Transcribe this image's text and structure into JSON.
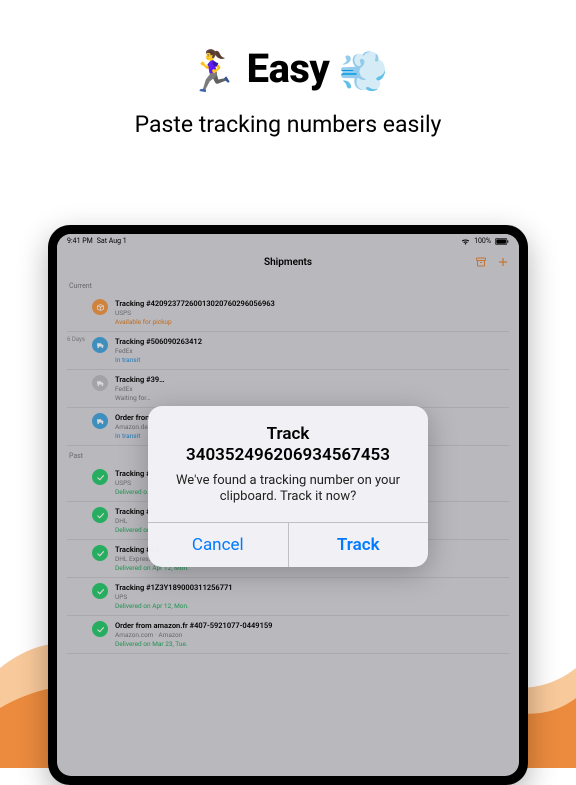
{
  "hero": {
    "emoji_left": "🏃‍♀️",
    "title": "Easy",
    "emoji_right": "💨",
    "subtitle": "Paste tracking numbers easily"
  },
  "status": {
    "time": "9:41 PM",
    "date": "Sat Aug 1",
    "battery": "100%"
  },
  "nav": {
    "title": "Shipments",
    "archive_icon": "archive-icon",
    "add_icon": "plus-icon"
  },
  "sections": {
    "current": "Current",
    "past": "Past"
  },
  "shipments_current": [
    {
      "pre": "",
      "icon": "orange",
      "glyph": "box",
      "title": "Tracking #42092377260013020760296056963",
      "sub": "USPS",
      "status": "Available for pickup",
      "status_cls": "c-orange"
    },
    {
      "pre": "6 Days",
      "icon": "blue",
      "glyph": "truck",
      "title": "Tracking #506090263412",
      "sub": "FedEx",
      "status": "In transit",
      "status_cls": "c-blue"
    },
    {
      "pre": "",
      "icon": "gray",
      "glyph": "truck",
      "title": "Tracking #39…",
      "sub": "FedEx",
      "status": "Waiting for…",
      "status_cls": "c-gray"
    },
    {
      "pre": "",
      "icon": "blue",
      "glyph": "truck",
      "title": "Order from…",
      "sub": "Amazon.de…",
      "status": "In transit",
      "status_cls": "c-blue"
    }
  ],
  "shipments_past": [
    {
      "pre": "",
      "icon": "green",
      "glyph": "check",
      "title": "Tracking #…",
      "sub": "USPS",
      "status": "Delivered o…",
      "status_cls": "c-green"
    },
    {
      "pre": "",
      "icon": "green",
      "glyph": "check",
      "title": "Tracking #…",
      "sub": "DHL",
      "status": "Delivered on…",
      "status_cls": "c-green"
    },
    {
      "pre": "",
      "icon": "green",
      "glyph": "check",
      "title": "Tracking #24…",
      "sub": "DHL Express",
      "status": "Delivered on Apr 12, Mon.",
      "status_cls": "c-green"
    },
    {
      "pre": "",
      "icon": "green",
      "glyph": "check",
      "title": "Tracking #1Z3Y189000311256771",
      "sub": "UPS",
      "status": "Delivered on Apr 12, Mon.",
      "status_cls": "c-green"
    },
    {
      "pre": "",
      "icon": "green",
      "glyph": "check",
      "title": "Order from amazon.fr #407-5921077-0449159",
      "sub": "Amazon.com · Amazon",
      "status": "Delivered on Mar 23, Tue.",
      "status_cls": "c-green"
    }
  ],
  "alert": {
    "title_line1": "Track",
    "title_line2": "34035249620693​4567453",
    "message": "We've found a tracking number on your clipboard. Track it now?",
    "cancel": "Cancel",
    "confirm": "Track"
  }
}
